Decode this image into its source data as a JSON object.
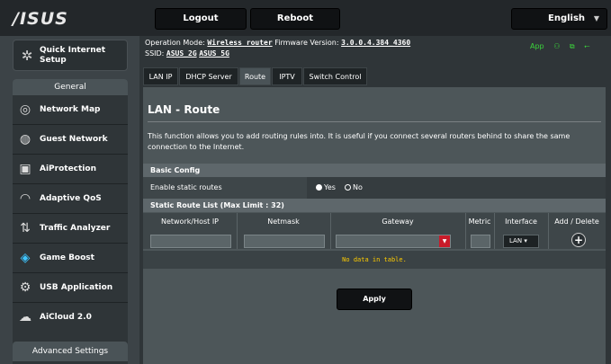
{
  "header": {
    "logo": "/ISUS",
    "logout": "Logout",
    "reboot": "Reboot",
    "language": "English"
  },
  "sidebar": {
    "quick_setup": "Quick Internet Setup",
    "general_title": "General",
    "items": [
      {
        "label": "Network Map",
        "icon": "network-map-icon"
      },
      {
        "label": "Guest Network",
        "icon": "guest-network-icon"
      },
      {
        "label": "AiProtection",
        "icon": "lock-icon"
      },
      {
        "label": "Adaptive QoS",
        "icon": "gauge-icon"
      },
      {
        "label": "Traffic Analyzer",
        "icon": "traffic-icon"
      },
      {
        "label": "Game Boost",
        "icon": "gamepad-icon"
      },
      {
        "label": "USB Application",
        "icon": "usb-icon"
      },
      {
        "label": "AiCloud 2.0",
        "icon": "cloud-icon"
      }
    ],
    "advanced_title": "Advanced Settings"
  },
  "status": {
    "op_mode_label": "Operation Mode:",
    "op_mode_value": "Wireless router",
    "fw_label": "Firmware Version:",
    "fw_value": "3.0.0.4.384_4360",
    "ssid_label": "SSID:",
    "ssid_1": "ASUS_2G",
    "ssid_2": "ASUS_5G",
    "app_label": "App"
  },
  "tabs": [
    "LAN IP",
    "DHCP Server",
    "Route",
    "IPTV",
    "Switch Control"
  ],
  "page": {
    "title": "LAN - Route",
    "description": "This function allows you to add routing rules into. It is useful if you connect several routers behind to share the same connection to the Internet.",
    "basic_config": "Basic Config",
    "enable_static_label": "Enable static routes",
    "yes": "Yes",
    "no": "No",
    "enable_static_value": "Yes",
    "list_title": "Static Route List (Max Limit : 32)",
    "columns": [
      "Network/Host IP",
      "Netmask",
      "Gateway",
      "Metric",
      "Interface",
      "Add / Delete"
    ],
    "interface_value": "LAN",
    "no_data": "No data in table.",
    "apply": "Apply"
  }
}
